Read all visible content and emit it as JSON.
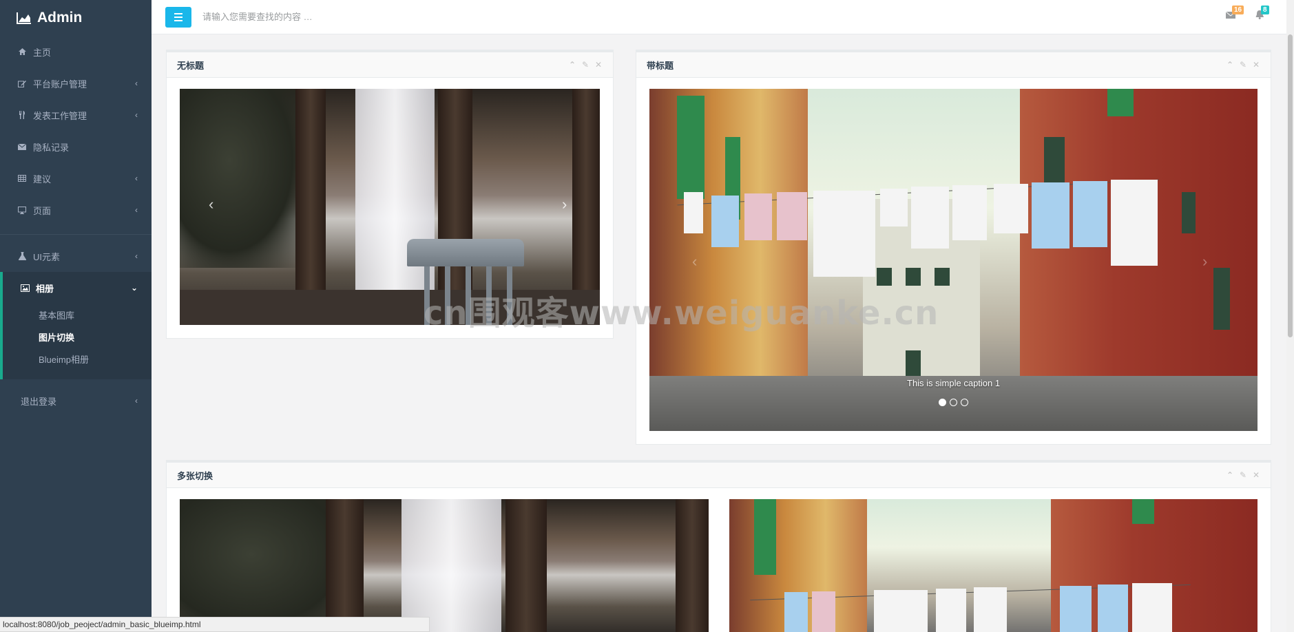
{
  "app": {
    "brand": "Admin"
  },
  "sidebar": {
    "items": [
      {
        "label": "主页",
        "icon": "home-icon",
        "has_arrow": false
      },
      {
        "label": "平台账户管理",
        "icon": "edit-icon",
        "has_arrow": true
      },
      {
        "label": "发表工作管理",
        "icon": "cutlery-icon",
        "has_arrow": true
      },
      {
        "label": "隐私记录",
        "icon": "envelope-icon",
        "has_arrow": false
      },
      {
        "label": "建议",
        "icon": "table-icon",
        "has_arrow": true
      },
      {
        "label": "页面",
        "icon": "desktop-icon",
        "has_arrow": true
      },
      {
        "label": "UI元素",
        "icon": "flask-icon",
        "has_arrow": true
      }
    ],
    "active": {
      "label": "相册",
      "icon": "picture-icon",
      "sub_items": [
        "基本图库",
        "图片切换",
        "Blueimp相册"
      ],
      "current_sub": 1
    },
    "logout": "退出登录"
  },
  "topbar": {
    "search_placeholder": "请输入您需要查找的内容 …",
    "mail_count": "16",
    "bell_count": "8"
  },
  "panels": {
    "p1": {
      "title": "无标题"
    },
    "p2": {
      "title": "带标题",
      "caption": "This is simple caption 1",
      "slides": 3,
      "active_slide": 0
    },
    "p3": {
      "title": "多张切换"
    }
  },
  "controls": {
    "prev": "‹",
    "next": "›"
  },
  "watermark": "cn围观客www.weiguanke.cn",
  "statusbar": "localhost:8080/job_peoject/admin_basic_blueimp.html",
  "colors": {
    "sidebar": "#2f4050",
    "accent": "#1ab7ea",
    "active_border": "#19aa8d",
    "badge_warn": "#f8ac59",
    "badge_info": "#23c6c8"
  }
}
